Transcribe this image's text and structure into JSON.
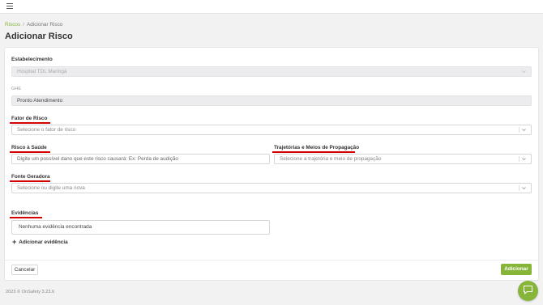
{
  "breadcrumb": {
    "root": "Riscos",
    "separator": "/",
    "current": "Adicionar Risco"
  },
  "page": {
    "title": "Adicionar Risco"
  },
  "form": {
    "estabelecimento": {
      "label": "Estabelecimento",
      "value": "Hospital TDL Maringá"
    },
    "ghe": {
      "label": "GHE",
      "value": "Pronto Atendimento"
    },
    "fator": {
      "label": "Fator de Risco",
      "placeholder": "Selecione o fator de risco"
    },
    "saude": {
      "label": "Risco à Saúde",
      "placeholder": "Digite um possível dano que este risco causará: Ex: Perda de audição"
    },
    "trajetorias": {
      "label": "Trajetórias e Meios de Propagação",
      "placeholder": "Selecione a trajetória e meio de propagação"
    },
    "fonte": {
      "label": "Fonte Geradora",
      "placeholder": "Selecione ou digite uma nova"
    },
    "evidencias": {
      "label": "Evidências",
      "empty": "Nenhuma evidência encontrada",
      "add_label": "Adicionar evidência"
    }
  },
  "actions": {
    "cancel": "Cancelar",
    "submit": "Adicionar"
  },
  "footer": {
    "text": "2023 © OnSafety 3.23.6"
  },
  "colors": {
    "accent": "#86b53a",
    "underline": "#d40000"
  },
  "icons": {
    "menu": "hamburger-icon",
    "chevron": "chevron-down-icon",
    "plus": "plus-icon",
    "chat": "chat-icon"
  }
}
